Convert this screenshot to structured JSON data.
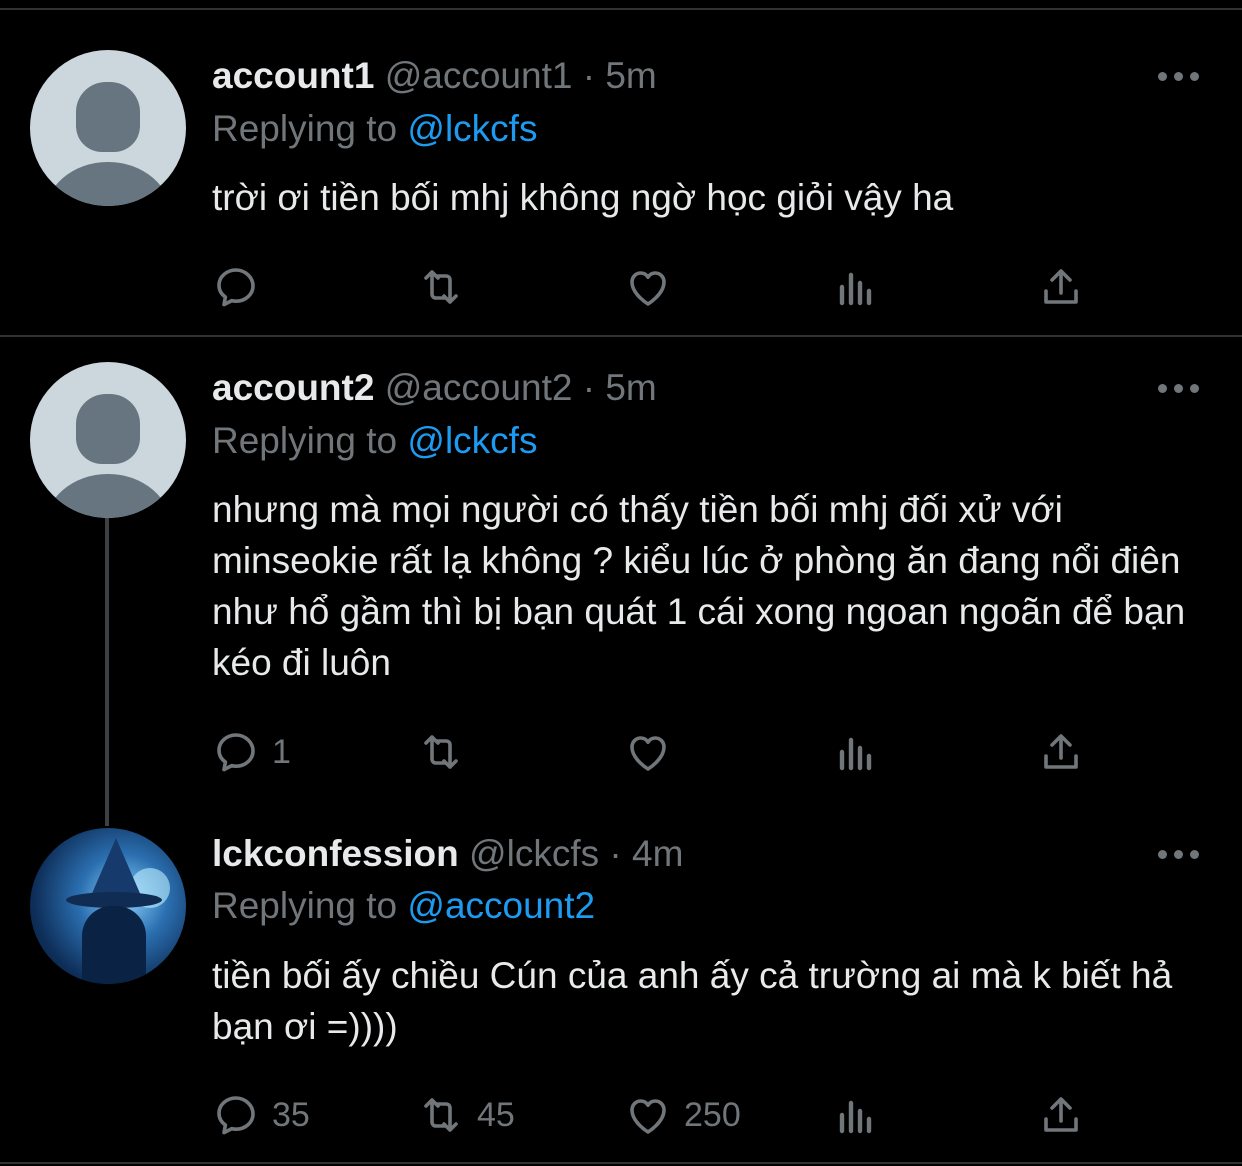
{
  "tweets": [
    {
      "name": "account1",
      "handle": "@account1",
      "separator": "·",
      "time": "5m",
      "replying_prefix": "Replying to",
      "replying_to": "@lckcfs",
      "text": "trời ơi tiền bối mhj không ngờ học giỏi vậy ha",
      "counts": {
        "reply": "",
        "retweet": "",
        "like": ""
      }
    },
    {
      "name": "account2",
      "handle": "@account2",
      "separator": "·",
      "time": "5m",
      "replying_prefix": "Replying to",
      "replying_to": "@lckcfs",
      "text": "nhưng mà mọi người có thấy tiền bối mhj đối xử với minseokie rất lạ không ? kiểu lúc ở phòng ăn đang nổi điên như hổ gầm thì bị bạn quát 1 cái xong ngoan ngoãn để bạn kéo đi luôn",
      "counts": {
        "reply": "1",
        "retweet": "",
        "like": ""
      }
    },
    {
      "name": "lckconfession",
      "handle": "@lckcfs",
      "separator": "·",
      "time": "4m",
      "replying_prefix": "Replying to",
      "replying_to": "@account2",
      "text": "tiền bối ấy chiều Cún của anh ấy cả trường ai mà k biết hả bạn ơi =))))",
      "counts": {
        "reply": "35",
        "retweet": "45",
        "like": "250"
      }
    }
  ],
  "icons": [
    "reply-icon",
    "retweet-icon",
    "like-icon",
    "analytics-icon",
    "share-icon",
    "more-icon",
    "default-avatar-icon"
  ],
  "colors": {
    "background": "#000000",
    "text": "#e7e9ea",
    "secondary": "#71767b",
    "mention": "#1d9bf0",
    "divider": "#2f3336"
  }
}
